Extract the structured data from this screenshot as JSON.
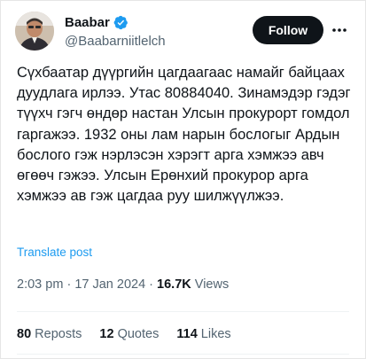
{
  "author": {
    "display_name": "Baabar",
    "handle": "@Baabarniitlelch",
    "verified": true,
    "avatar_icon": "profile-photo",
    "verified_color": "#1d9bf0"
  },
  "actions": {
    "follow_label": "Follow",
    "more_icon": "more-dots-icon"
  },
  "tweet": {
    "text": "Сүхбаатар дүүргийн цагдаагаас намайг байцаах дуудлага ирлээ. Утас 80884040. Зинамэдэр гэдэг түүхч гэгч өндөр настан Улсын прокурорт гомдол гаргажээ. 1932 оны лам нарын бослогыг Ардын бослого гэж нэрлэсэн хэрэгт арга хэмжээ авч өгөөч гэжээ. Улсын Ерөнхий прокурор арга хэмжээ ав гэж цагдаа руу шилжүүлжээ.",
    "translate_label": "Translate post"
  },
  "meta": {
    "time": "2:03 pm",
    "date": "17 Jan 2024",
    "views_count": "16.7K",
    "views_label": "Views",
    "sep": "·"
  },
  "stats": {
    "reposts_count": "80",
    "reposts_label": "Reposts",
    "quotes_count": "12",
    "quotes_label": "Quotes",
    "likes_count": "114",
    "likes_label": "Likes"
  },
  "colors": {
    "text": "#0f1419",
    "secondary": "#536471",
    "link": "#1d9bf0",
    "button_bg": "#0f1419"
  }
}
